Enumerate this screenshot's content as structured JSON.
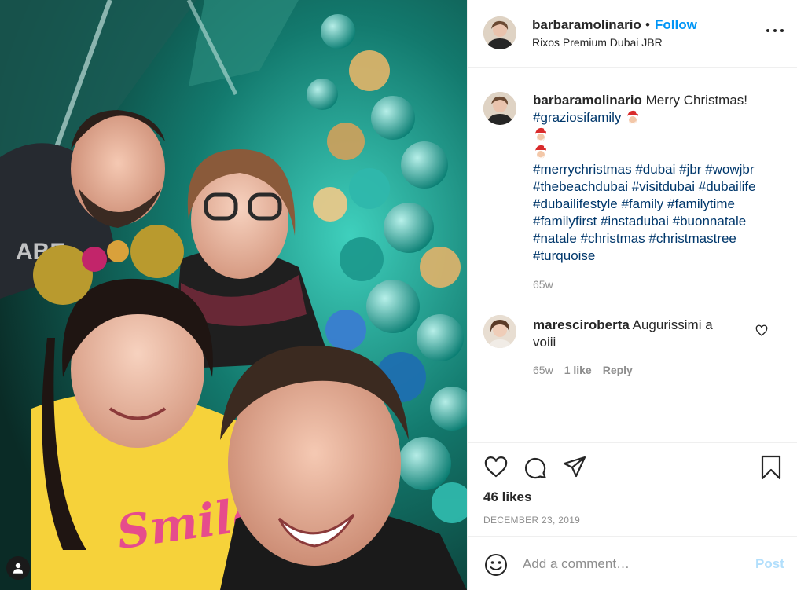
{
  "post": {
    "username": "barbaramolinario",
    "separator": "•",
    "follow_label": "Follow",
    "location": "Rixos Premium Dubai JBR",
    "more_icon": "more-horizontal-icon"
  },
  "photo": {
    "description_icon": "tag-people-icon",
    "shirt_text": "Smile",
    "hoodie_text": "ABE AND"
  },
  "caption": {
    "username": "barbaramolinario",
    "text": "Merry Christmas!",
    "first_hashtag": "#graziosifamily",
    "emoji": "santa-emoji",
    "hashtag_lines": [
      "#merrychristmas #dubai #jbr #wowjbr",
      "#thebeachdubai #visitdubai #dubailife",
      "#dubailifestyle #family #familytime",
      "#familyfirst #instadubai #buonnatale",
      "#natale #christmas #christmastree",
      "#turquoise"
    ],
    "age": "65w"
  },
  "comments": [
    {
      "username": "maresciroberta",
      "text": "Augurissimi a voiii",
      "age": "65w",
      "likes": "1 like",
      "reply_label": "Reply"
    }
  ],
  "actions": {
    "like_icon": "heart-icon",
    "comment_icon": "comment-icon",
    "share_icon": "paper-plane-icon",
    "save_icon": "bookmark-icon",
    "likes": "46 likes",
    "date": "DECEMBER 23, 2019"
  },
  "add_comment": {
    "placeholder": "Add a comment…",
    "post_label": "Post"
  },
  "colors": {
    "link_blue": "#0095f6",
    "hashtag_blue": "#00376b",
    "muted": "#8e8e8e",
    "post_disabled": "#b2dffc",
    "tree_teal": "#1bb9a8"
  }
}
